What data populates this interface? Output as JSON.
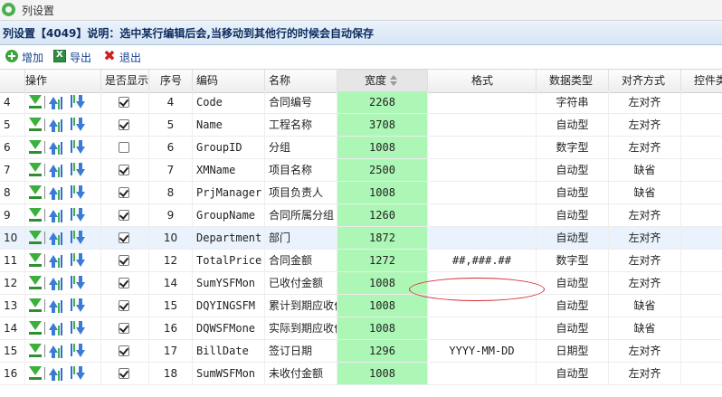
{
  "window": {
    "title": "列设置"
  },
  "panel": {
    "header": "列设置【4049】说明：选中某行编辑后会,当移动到其他行的时候会自动保存"
  },
  "toolbar": {
    "add_label": "增加",
    "export_label": "导出",
    "exit_label": "退出"
  },
  "grid": {
    "columns": [
      "操作",
      "是否显示",
      "序号",
      "编码",
      "名称",
      "宽度",
      "格式",
      "数据类型",
      "对齐方式",
      "控件类"
    ],
    "rows": [
      {
        "rownum": "4",
        "visible": true,
        "seq": "4",
        "code": "Code",
        "name": "合同编号",
        "width": "2268",
        "format": "",
        "dtype": "字符串",
        "align": "左对齐"
      },
      {
        "rownum": "5",
        "visible": true,
        "seq": "5",
        "code": "Name",
        "name": "工程名称",
        "width": "3708",
        "format": "",
        "dtype": "自动型",
        "align": "左对齐"
      },
      {
        "rownum": "6",
        "visible": false,
        "seq": "6",
        "code": "GroupID",
        "name": "分组",
        "width": "1008",
        "format": "",
        "dtype": "数字型",
        "align": "左对齐"
      },
      {
        "rownum": "7",
        "visible": true,
        "seq": "7",
        "code": "XMName",
        "name": "项目名称",
        "width": "2500",
        "format": "",
        "dtype": "自动型",
        "align": "缺省"
      },
      {
        "rownum": "8",
        "visible": true,
        "seq": "8",
        "code": "PrjManager",
        "name": "项目负责人",
        "width": "1008",
        "format": "",
        "dtype": "自动型",
        "align": "缺省"
      },
      {
        "rownum": "9",
        "visible": true,
        "seq": "9",
        "code": "GroupName",
        "name": "合同所属分组",
        "width": "1260",
        "format": "",
        "dtype": "自动型",
        "align": "左对齐"
      },
      {
        "rownum": "10",
        "visible": true,
        "seq": "10",
        "code": "Department",
        "name": "部门",
        "width": "1872",
        "format": "",
        "dtype": "自动型",
        "align": "左对齐"
      },
      {
        "rownum": "11",
        "visible": true,
        "seq": "12",
        "code": "TotalPrice",
        "name": "合同金额",
        "width": "1272",
        "format": "##,###.##",
        "dtype": "数字型",
        "align": "左对齐"
      },
      {
        "rownum": "12",
        "visible": true,
        "seq": "14",
        "code": "SumYSFMon",
        "name": "已收付金额",
        "width": "1008",
        "format": "",
        "dtype": "自动型",
        "align": "左对齐"
      },
      {
        "rownum": "13",
        "visible": true,
        "seq": "15",
        "code": "DQYINGSFM",
        "name": "累计到期应收付",
        "width": "1008",
        "format": "",
        "dtype": "自动型",
        "align": "缺省"
      },
      {
        "rownum": "14",
        "visible": true,
        "seq": "16",
        "code": "DQWSFMone",
        "name": "实际到期应收付",
        "width": "1008",
        "format": "",
        "dtype": "自动型",
        "align": "缺省"
      },
      {
        "rownum": "15",
        "visible": true,
        "seq": "17",
        "code": "BillDate",
        "name": "签订日期",
        "width": "1296",
        "format": "YYYY-MM-DD",
        "dtype": "日期型",
        "align": "左对齐"
      },
      {
        "rownum": "16",
        "visible": true,
        "seq": "18",
        "code": "SumWSFMon",
        "name": "未收付金额",
        "width": "1008",
        "format": "",
        "dtype": "自动型",
        "align": "左对齐"
      }
    ],
    "selected_row": 6
  },
  "colors": {
    "width_column": "#adf7b6",
    "selected_row": "#eaf2fd",
    "annotation": "#d62b2b"
  }
}
